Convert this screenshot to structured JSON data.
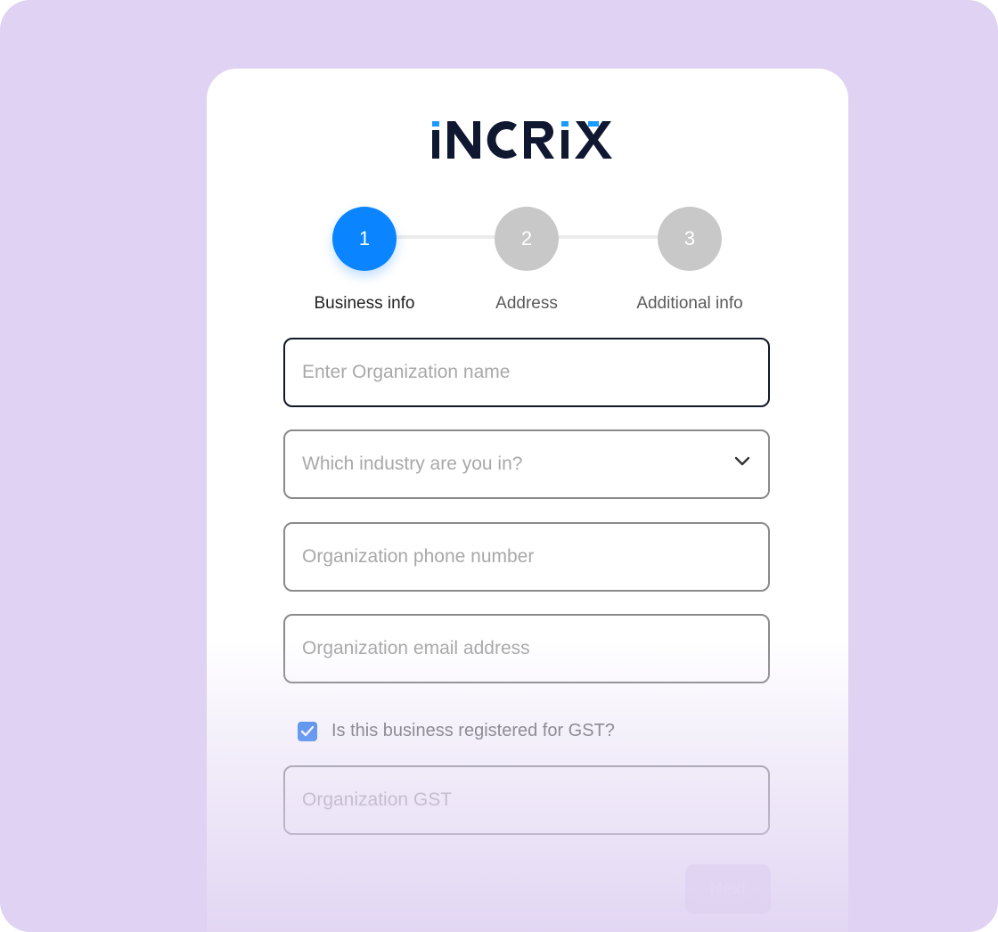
{
  "brand": {
    "logo_text": "iNCRiX",
    "accent": "#1a9bff",
    "dark": "#0f1830"
  },
  "stepper": {
    "steps": [
      {
        "number": "1",
        "label": "Business info",
        "active": true
      },
      {
        "number": "2",
        "label": "Address",
        "active": false
      },
      {
        "number": "3",
        "label": "Additional info",
        "active": false
      }
    ]
  },
  "form": {
    "org_name": {
      "placeholder": "Enter Organization name",
      "value": ""
    },
    "industry": {
      "placeholder": "Which industry are you in?",
      "icon": "chevron-down-icon"
    },
    "phone": {
      "placeholder": "Organization phone number",
      "value": ""
    },
    "email": {
      "placeholder": "Organization email address",
      "value": ""
    },
    "gst_checkbox": {
      "label": "Is this business registered for GST?",
      "checked": true
    },
    "gst": {
      "placeholder": "Organization GST",
      "value": ""
    }
  },
  "actions": {
    "next_label": "Next"
  },
  "colors": {
    "background": "#dfd2f2",
    "primary": "#0a84ff",
    "inactive_step": "#c8c8c8"
  }
}
